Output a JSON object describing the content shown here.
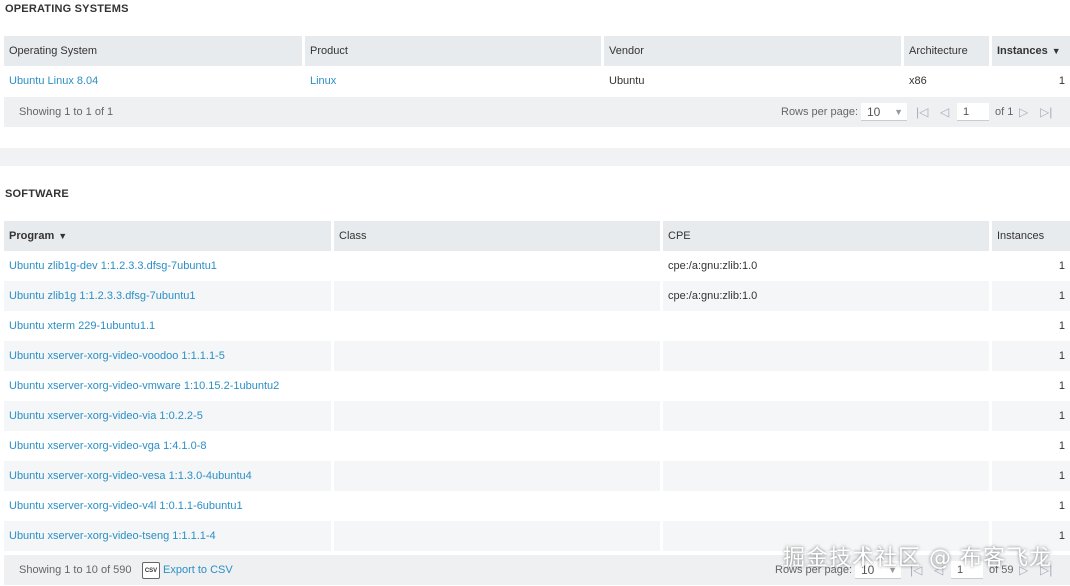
{
  "os_section": {
    "title": "OPERATING SYSTEMS",
    "columns": [
      "Operating System",
      "Product",
      "Vendor",
      "Architecture",
      "Instances"
    ],
    "rows": [
      {
        "os": "Ubuntu Linux 8.04",
        "product": "Linux",
        "vendor": "Ubuntu",
        "arch": "x86",
        "instances": "1"
      }
    ],
    "pager": {
      "showing": "Showing 1 to 1 of 1",
      "rows_per_page_label": "Rows per page:",
      "rows_per_page": "10",
      "page": "1",
      "of_pages": "of 1"
    }
  },
  "software_section": {
    "title": "SOFTWARE",
    "columns": [
      "Program",
      "Class",
      "CPE",
      "Instances"
    ],
    "rows": [
      {
        "program": "Ubuntu zlib1g-dev 1:1.2.3.3.dfsg-7ubuntu1",
        "class": "",
        "cpe": "cpe:/a:gnu:zlib:1.0",
        "instances": "1"
      },
      {
        "program": "Ubuntu zlib1g 1:1.2.3.3.dfsg-7ubuntu1",
        "class": "",
        "cpe": "cpe:/a:gnu:zlib:1.0",
        "instances": "1"
      },
      {
        "program": "Ubuntu xterm 229-1ubuntu1.1",
        "class": "",
        "cpe": "",
        "instances": "1"
      },
      {
        "program": "Ubuntu xserver-xorg-video-voodoo 1:1.1.1-5",
        "class": "",
        "cpe": "",
        "instances": "1"
      },
      {
        "program": "Ubuntu xserver-xorg-video-vmware 1:10.15.2-1ubuntu2",
        "class": "",
        "cpe": "",
        "instances": "1"
      },
      {
        "program": "Ubuntu xserver-xorg-video-via 1:0.2.2-5",
        "class": "",
        "cpe": "",
        "instances": "1"
      },
      {
        "program": "Ubuntu xserver-xorg-video-vga 1:4.1.0-8",
        "class": "",
        "cpe": "",
        "instances": "1"
      },
      {
        "program": "Ubuntu xserver-xorg-video-vesa 1:1.3.0-4ubuntu4",
        "class": "",
        "cpe": "",
        "instances": "1"
      },
      {
        "program": "Ubuntu xserver-xorg-video-v4l 1:0.1.1-6ubuntu1",
        "class": "",
        "cpe": "",
        "instances": "1"
      },
      {
        "program": "Ubuntu xserver-xorg-video-tseng 1:1.1.1-4",
        "class": "",
        "cpe": "",
        "instances": "1"
      }
    ],
    "pager": {
      "showing": "Showing 1 to 10 of 590",
      "csv_icon_text": "CSV",
      "export_label": "Export to CSV",
      "rows_per_page_label": "Rows per page:",
      "rows_per_page": "10",
      "page": "1",
      "of_pages": "of 59"
    }
  },
  "watermark": "掘金技术社区 @ 布客飞龙",
  "icons": {
    "sort": "chevron-down-icon",
    "first": "first-page-icon",
    "prev": "prev-page-icon",
    "next": "next-page-icon",
    "last": "last-page-icon",
    "csv": "csv-file-icon"
  },
  "colors": {
    "link": "#2b8fc6",
    "header_bg": "#e8ebee",
    "pager_bg": "#eef0f2"
  }
}
